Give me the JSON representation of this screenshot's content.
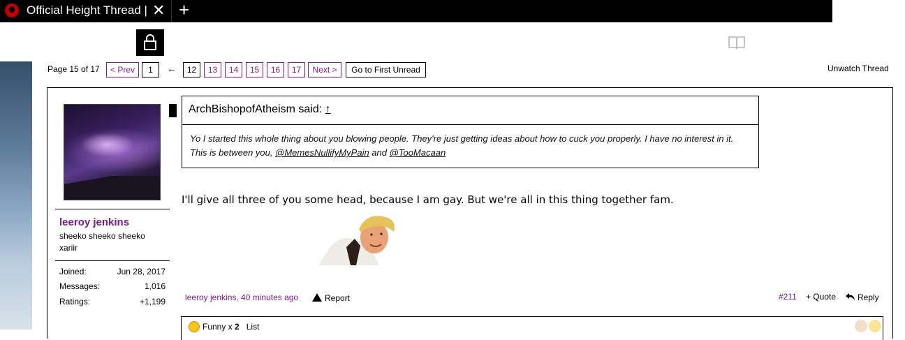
{
  "browser": {
    "tab_title": "Official Height Thread |",
    "close_symbol": "✕",
    "new_tab_symbol": "+"
  },
  "toolbar": {
    "lock_icon": "lock-icon",
    "reader_icon": "book-icon"
  },
  "pagination": {
    "label": "Page 15 of 17",
    "prev": "< Prev",
    "first_page": "1",
    "ellipsis_arrow": "←",
    "pages": [
      "12",
      "13",
      "14",
      "15",
      "16",
      "17"
    ],
    "next": "Next >",
    "first_unread": "Go to First Unread",
    "current_page": "15"
  },
  "unwatch": "Unwatch Thread",
  "post": {
    "author": {
      "name": "leeroy jenkins",
      "title": "sheeko sheeko sheeko xariir",
      "stats": [
        {
          "label": "Joined:",
          "value": "Jun 28, 2017"
        },
        {
          "label": "Messages:",
          "value": "1,016"
        },
        {
          "label": "Ratings:",
          "value": "+1,199"
        }
      ]
    },
    "quote": {
      "attribution": "ArchBishopofAtheism said:",
      "up_arrow": "↑",
      "text_before": "Yo I started this whole thing about you blowing people. They're just getting ideas about how to cuck you properly. I have no interest in it. This is between you, ",
      "mention1": "@MemesNullifyMyPain",
      "text_middle": " and ",
      "mention2": "@TooMacaan"
    },
    "message": "I'll give all three of you some head, because I am gay. But we're all in this thing together fam.",
    "byline": "leeroy jenkins, 40 minutes ago",
    "report": "Report",
    "post_number": "#211",
    "quote_action": "+ Quote",
    "reply_action": "Reply",
    "ratings": {
      "label": "Funny x ",
      "count": "2",
      "list": "List"
    }
  },
  "colors": {
    "link_purple": "#7b1a8a",
    "page_border": "#8a1c8a",
    "tabbar": "#000000"
  }
}
